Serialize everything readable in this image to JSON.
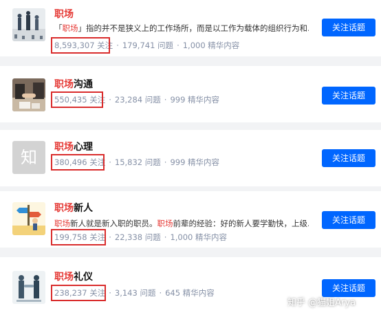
{
  "topics": [
    {
      "title_hl": "职场",
      "title_rest": "",
      "desc_parts": [
        {
          "t": "「",
          "hl": false
        },
        {
          "t": "职场",
          "hl": true
        },
        {
          "t": "」指的并不是狭义上的工作场所，而是以工作为载体的组织行为和...",
          "hl": false
        }
      ],
      "followers": "8,593,307 关注",
      "questions": "179,741 问题",
      "featured": "1,000 精华内容",
      "button": "关注话题",
      "thumb_icon": "office-people-icon"
    },
    {
      "title_hl": "职场",
      "title_rest": "沟通",
      "desc_parts": [],
      "followers": "550,435 关注",
      "questions": "23,284 问题",
      "featured": "999 精华内容",
      "button": "关注话题",
      "thumb_icon": "handshake-meeting-icon"
    },
    {
      "title_hl": "职场",
      "title_rest": "心理",
      "desc_parts": [],
      "followers": "380,496 关注",
      "questions": "15,832 问题",
      "featured": "999 精华内容",
      "button": "关注话题",
      "thumb_icon": "placeholder-zhi-icon",
      "thumb_text": "知"
    },
    {
      "title_hl": "职场",
      "title_rest": "新人",
      "desc_parts": [
        {
          "t": "职场",
          "hl": true
        },
        {
          "t": "新人就是新入职的职员。",
          "hl": false
        },
        {
          "t": "职场",
          "hl": true
        },
        {
          "t": "前辈的经验：好的新人要学勤快，上级...",
          "hl": false
        }
      ],
      "followers": "199,758 关注",
      "questions": "22,338 问题",
      "featured": "1,000 精华内容",
      "button": "关注话题",
      "thumb_icon": "crossroads-newcomer-icon"
    },
    {
      "title_hl": "职场",
      "title_rest": "礼仪",
      "desc_parts": [],
      "followers": "238,237 关注",
      "questions": "3,143 问题",
      "featured": "645 精华内容",
      "button": "关注话题",
      "thumb_icon": "business-handshake-icon"
    }
  ],
  "watermark": "知乎 @猫姐Arya",
  "colors": {
    "accent": "#0066ff",
    "highlight": "#e53935",
    "box": "#d92b2b",
    "meta": "#8590a6"
  }
}
